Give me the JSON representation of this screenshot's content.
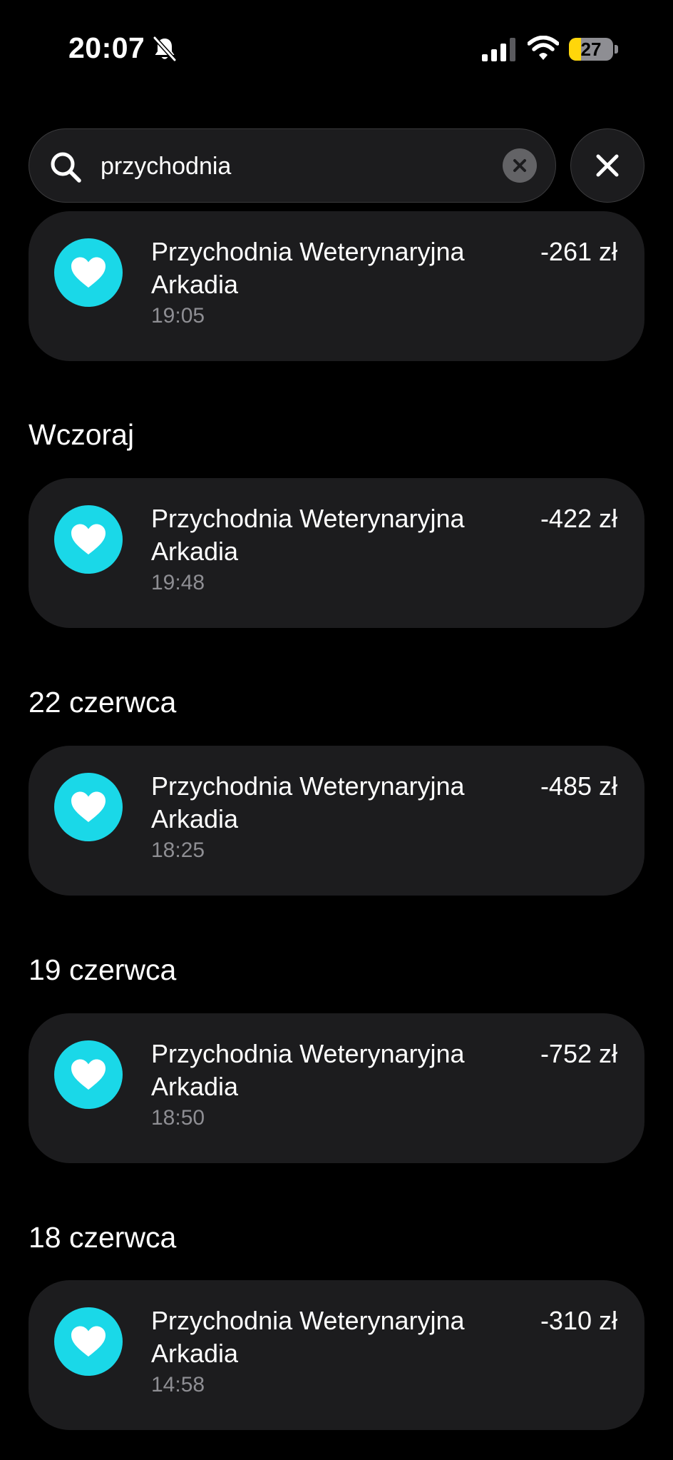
{
  "status_bar": {
    "time": "20:07",
    "battery_level": "27",
    "battery_fraction": 0.27,
    "icons": [
      "bell-slash-icon",
      "signal-icon",
      "wifi-icon",
      "battery-icon"
    ]
  },
  "search": {
    "query": "przychodnia",
    "icon": "search-icon",
    "clear_icon": "clear-circle-icon",
    "close_icon": "close-icon"
  },
  "colors": {
    "background": "#000000",
    "card": "#1c1c1e",
    "avatar": "#1ad8e8",
    "secondary_text": "#8e8e93",
    "battery_fill": "#ffd60a"
  },
  "sections": [
    {
      "header": "",
      "transactions": [
        {
          "name": "Przychodnia Weterynaryjna Arkadia",
          "time": "19:05",
          "amount": "-261 zł",
          "icon": "heart-icon"
        }
      ]
    },
    {
      "header": "Wczoraj",
      "transactions": [
        {
          "name": "Przychodnia Weterynaryjna Arkadia",
          "time": "19:48",
          "amount": "-422 zł",
          "icon": "heart-icon"
        }
      ]
    },
    {
      "header": "22 czerwca",
      "transactions": [
        {
          "name": "Przychodnia Weterynaryjna Arkadia",
          "time": "18:25",
          "amount": "-485 zł",
          "icon": "heart-icon"
        }
      ]
    },
    {
      "header": "19 czerwca",
      "transactions": [
        {
          "name": "Przychodnia Weterynaryjna Arkadia",
          "time": "18:50",
          "amount": "-752 zł",
          "icon": "heart-icon"
        }
      ]
    },
    {
      "header": "18 czerwca",
      "transactions": [
        {
          "name": "Przychodnia Weterynaryjna Arkadia",
          "time": "14:58",
          "amount": "-310 zł",
          "icon": "heart-icon"
        }
      ]
    }
  ]
}
